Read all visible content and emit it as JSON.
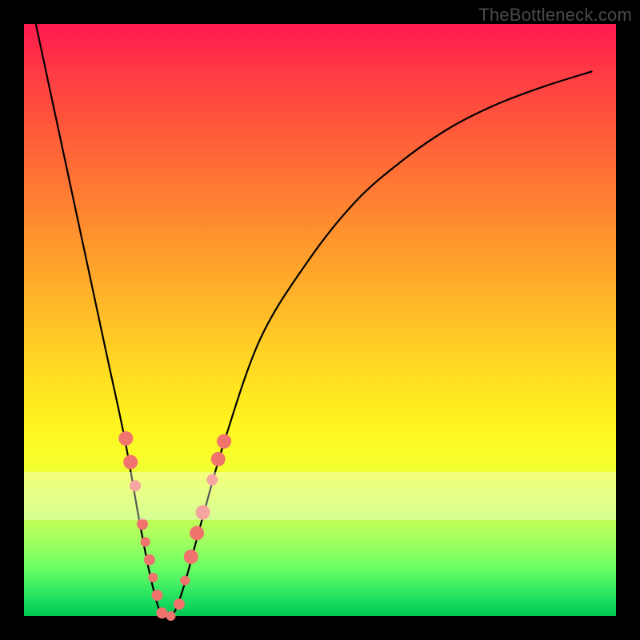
{
  "watermark": "TheBottleneck.com",
  "chart_data": {
    "type": "line",
    "title": "",
    "xlabel": "",
    "ylabel": "",
    "xlim": [
      0,
      1
    ],
    "ylim": [
      0,
      1
    ],
    "grid": false,
    "series": [
      {
        "name": "v-curve",
        "x": [
          0.02,
          0.05,
          0.08,
          0.11,
          0.14,
          0.17,
          0.195,
          0.215,
          0.233,
          0.25,
          0.27,
          0.3,
          0.34,
          0.4,
          0.48,
          0.56,
          0.64,
          0.72,
          0.8,
          0.88,
          0.96
        ],
        "y": [
          1.0,
          0.86,
          0.72,
          0.58,
          0.44,
          0.3,
          0.16,
          0.06,
          0.0,
          0.0,
          0.05,
          0.16,
          0.3,
          0.47,
          0.6,
          0.7,
          0.77,
          0.825,
          0.865,
          0.895,
          0.92
        ]
      }
    ],
    "highlight_band_y": [
      0.19,
      0.27
    ],
    "dots": [
      {
        "x": 0.172,
        "y": 0.3,
        "size": "big"
      },
      {
        "x": 0.18,
        "y": 0.26,
        "size": "big"
      },
      {
        "x": 0.188,
        "y": 0.22,
        "size": "med"
      },
      {
        "x": 0.2,
        "y": 0.155,
        "size": "med"
      },
      {
        "x": 0.205,
        "y": 0.125,
        "size": "sm"
      },
      {
        "x": 0.212,
        "y": 0.095,
        "size": "med"
      },
      {
        "x": 0.218,
        "y": 0.065,
        "size": "sm"
      },
      {
        "x": 0.225,
        "y": 0.035,
        "size": "med"
      },
      {
        "x": 0.233,
        "y": 0.005,
        "size": "med"
      },
      {
        "x": 0.248,
        "y": 0.0,
        "size": "sm"
      },
      {
        "x": 0.262,
        "y": 0.02,
        "size": "med"
      },
      {
        "x": 0.272,
        "y": 0.06,
        "size": "sm"
      },
      {
        "x": 0.282,
        "y": 0.1,
        "size": "big"
      },
      {
        "x": 0.292,
        "y": 0.14,
        "size": "big"
      },
      {
        "x": 0.302,
        "y": 0.175,
        "size": "big"
      },
      {
        "x": 0.318,
        "y": 0.23,
        "size": "med"
      },
      {
        "x": 0.328,
        "y": 0.265,
        "size": "big"
      },
      {
        "x": 0.338,
        "y": 0.295,
        "size": "big"
      }
    ]
  }
}
